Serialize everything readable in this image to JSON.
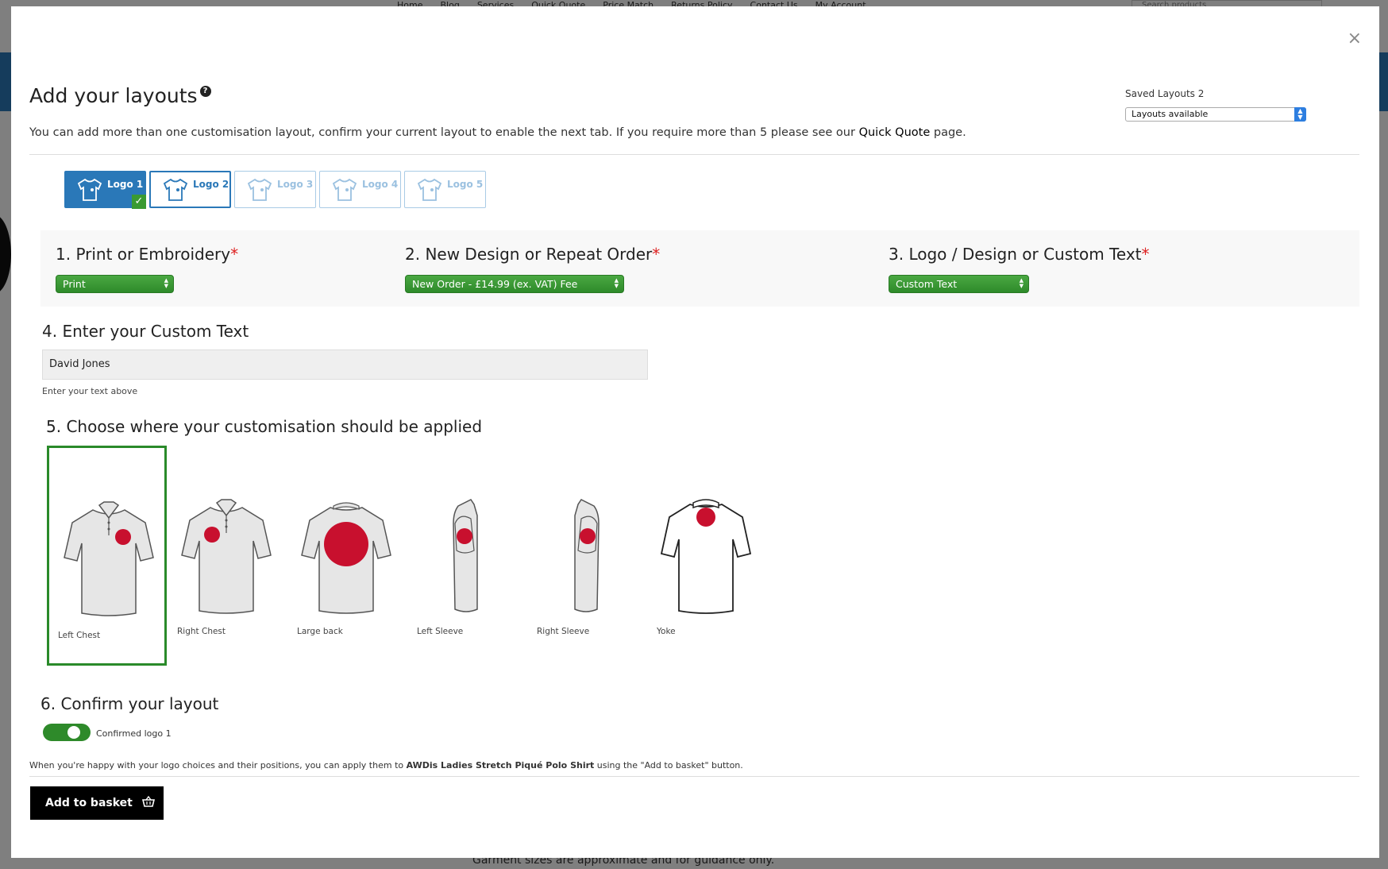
{
  "background": {
    "nav": [
      "Home",
      "Blog",
      "Services",
      "Quick Quote",
      "Price Match",
      "Returns Policy",
      "Contact Us",
      "My Account"
    ],
    "search_placeholder": "Search products",
    "footer_text": "Garment sizes are approximate and for guidance only."
  },
  "modal": {
    "close_icon": "×",
    "title": "Add your layouts",
    "help_icon": "?",
    "intro_before": "You can add more than one customisation layout, confirm your current layout to enable the next tab. If you require more than 5 please see our ",
    "intro_link": "Quick Quote",
    "intro_after": " page.",
    "saved_layouts_label": "Saved Layouts 2",
    "saved_layouts_value": "Layouts available"
  },
  "tabs": [
    {
      "label": "Logo 1",
      "state": "active"
    },
    {
      "label": "Logo 2",
      "state": "current"
    },
    {
      "label": "Logo 3",
      "state": "disabled"
    },
    {
      "label": "Logo 4",
      "state": "disabled"
    },
    {
      "label": "Logo 5",
      "state": "disabled"
    }
  ],
  "steps": {
    "step1": {
      "title": "1. Print or Embroidery",
      "required": "*",
      "value": "Print"
    },
    "step2": {
      "title": "2. New Design or Repeat Order",
      "required": "*",
      "value": "New Order - £14.99 (ex. VAT) Fee"
    },
    "step3": {
      "title": "3. Logo / Design or Custom Text",
      "required": "*",
      "value": "Custom Text"
    },
    "step4": {
      "title": "4. Enter your Custom Text",
      "value": "David Jones",
      "help": "Enter your text above"
    },
    "step5": {
      "title": "5. Choose where your customisation should be applied"
    },
    "step6": {
      "title": "6. Confirm your layout",
      "toggle_label": "Confirmed logo 1"
    }
  },
  "positions": [
    {
      "label": "Left Chest",
      "selected": true
    },
    {
      "label": "Right Chest",
      "selected": false
    },
    {
      "label": "Large back",
      "selected": false
    },
    {
      "label": "Left Sleeve",
      "selected": false
    },
    {
      "label": "Right Sleeve",
      "selected": false
    },
    {
      "label": "Yoke",
      "selected": false
    }
  ],
  "note": {
    "before": "When you're happy with your logo choices and their positions, you can apply them to ",
    "product": "AWDis Ladies Stretch Piqué Polo Shirt",
    "after": " using the \"Add to basket\" button."
  },
  "basket_button": "Add to basket",
  "colors": {
    "accent_blue": "#2a78b8",
    "green": "#2e8a2a",
    "marker_red": "#c8102e"
  }
}
